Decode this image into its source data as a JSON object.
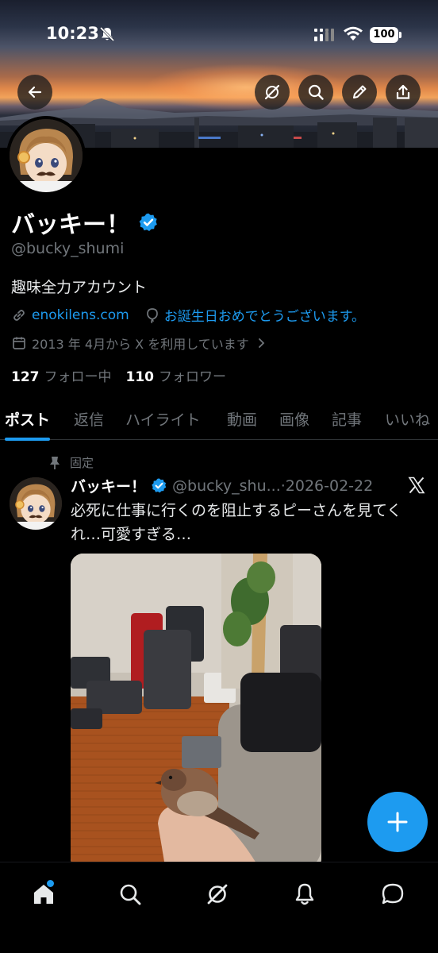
{
  "status_bar": {
    "time": "10:23",
    "battery": "100"
  },
  "header_buttons": [
    "back-icon",
    "grok-icon",
    "search-icon",
    "edit-icon",
    "share-icon"
  ],
  "profile": {
    "display_name": "バッキー！",
    "handle": "@bucky_shumi",
    "bio": "趣味全力アカウント",
    "website": "enokilens.com",
    "birthday": "お誕生日おめでとうございます。",
    "joined": "2013 年 4月から X を利用しています",
    "following_count": "127",
    "following_label": "フォロー中",
    "followers_count": "110",
    "followers_label": "フォロワー"
  },
  "tabs": [
    {
      "label": "ポスト",
      "active": true
    },
    {
      "label": "返信"
    },
    {
      "label": "ハイライト"
    },
    {
      "label": "動画"
    },
    {
      "label": "画像"
    },
    {
      "label": "記事"
    },
    {
      "label": "いいね"
    }
  ],
  "post": {
    "pinned_label": "固定",
    "author_name": "バッキー！",
    "author_handle": "@bucky_shu...",
    "separator": "·",
    "date": "2026-02-22",
    "text": "必死に仕事に行くのを阻止するピーさんを見てくれ…可愛すぎる…"
  },
  "colors": {
    "accent": "#1d9bf0",
    "background": "#000000",
    "text": "#e7e9ea",
    "secondary_text": "#71767b"
  },
  "bottom_nav": [
    "home-icon",
    "search-icon",
    "grok-icon",
    "notifications-icon",
    "messages-icon"
  ]
}
